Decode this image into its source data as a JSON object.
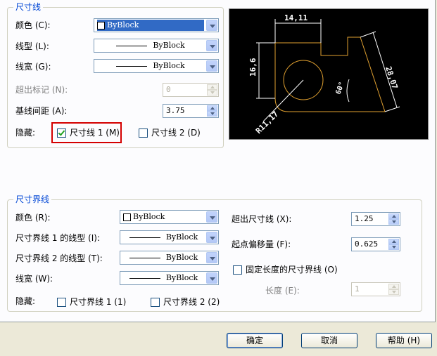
{
  "dim_line": {
    "legend": "尺寸线",
    "color_label": "颜色 (C):",
    "color_value": "ByBlock",
    "linetype_label": "线型 (L):",
    "linetype_value": "ByBlock",
    "lineweight_label": "线宽 (G):",
    "lineweight_value": "ByBlock",
    "extend_ticks_label": "超出标记 (N):",
    "extend_ticks_value": "0",
    "baseline_spacing_label": "基线间距 (A):",
    "baseline_spacing_value": "3.75",
    "suppress_label": "隐藏:",
    "suppress_1_label": "尺寸线 1 (M)",
    "suppress_1_checked": true,
    "suppress_2_label": "尺寸线 2 (D)",
    "suppress_2_checked": false
  },
  "preview": {
    "dim_top": "14,11",
    "dim_left": "16,6",
    "dim_right": "28,07",
    "dim_angle": "60°",
    "dim_radius": "R11,17",
    "line_color": "#e0a030",
    "dim_color": "#ffffff"
  },
  "ext_line": {
    "legend": "尺寸界线",
    "color_label": "颜色 (R):",
    "color_value": "ByBlock",
    "linetype1_label": "尺寸界线 1 的线型 (I):",
    "linetype1_value": "ByBlock",
    "linetype2_label": "尺寸界线 2 的线型 (T):",
    "linetype2_value": "ByBlock",
    "lineweight_label": "线宽 (W):",
    "lineweight_value": "ByBlock",
    "suppress_label": "隐藏:",
    "suppress_1_label": "尺寸界线 1 (1)",
    "suppress_2_label": "尺寸界线 2 (2)",
    "extend_beyond_label": "超出尺寸线 (X):",
    "extend_beyond_value": "1.25",
    "offset_label": "起点偏移量 (F):",
    "offset_value": "0.625",
    "fixed_length_label": "固定长度的尺寸界线 (O)",
    "length_label": "长度 (E):",
    "length_value": "1"
  },
  "buttons": {
    "ok": "确定",
    "cancel": "取消",
    "help": "帮助 (H)"
  }
}
